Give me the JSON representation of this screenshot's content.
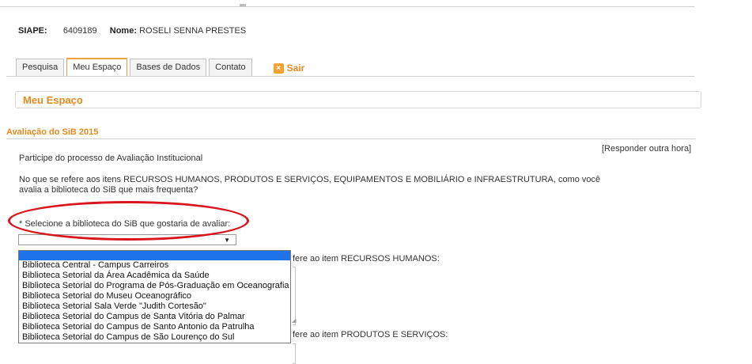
{
  "user": {
    "siape_label": "SIAPE:",
    "siape_value": "6409189",
    "name_label": "Nome:",
    "name_value": "ROSELI SENNA PRESTES"
  },
  "tabs": [
    {
      "label": "Pesquisa",
      "active": false
    },
    {
      "label": "Meu Espaço",
      "active": true
    },
    {
      "label": "Bases de Dados",
      "active": false
    },
    {
      "label": "Contato",
      "active": false
    }
  ],
  "logout": {
    "label": "Sair",
    "icon": "close-x-icon"
  },
  "panel": {
    "title": "Meu Espaço"
  },
  "section": {
    "title": "Avaliação do SiB 2015",
    "intro": "Participe do processo de Avaliação Institucional",
    "answer_later": "[Responder outra hora]",
    "question": "No que se refere aos itens RECURSOS HUMANOS, PRODUTOS E SERVIÇOS, EQUIPAMENTOS E MOBILIÁRIO e INFRAESTRUTURA, como você avalia a biblioteca do SiB que mais frequenta?",
    "select_label": "* Selecione a biblioteca do SiB que gostaria de avaliar:",
    "select_value": "",
    "options": [
      "",
      "Biblioteca Central - Campus Carreiros",
      "Biblioteca Setorial da Área Acadêmica da Saúde",
      "Biblioteca Setorial do Programa de Pós-Graduação em Oceanografia",
      "Biblioteca Setorial do Museu Oceanográfico",
      "Biblioteca Setorial Sala Verde \"Judith Cortesão\"",
      "Biblioteca Setorial do Campus de Santa Vitória do Palmar",
      "Biblioteca Setorial do Campus de Santo Antonio da Patrulha",
      "Biblioteca Setorial do Campus de São Lourenço do Sul"
    ],
    "partial_rh": "fere ao item RECURSOS HUMANOS:",
    "partial_ps": "fere ao item PRODUTOS E SERVIÇOS:"
  },
  "colors": {
    "accent": "#e8891e",
    "highlight": "#1e73e8",
    "annotation": "#d9161d"
  }
}
